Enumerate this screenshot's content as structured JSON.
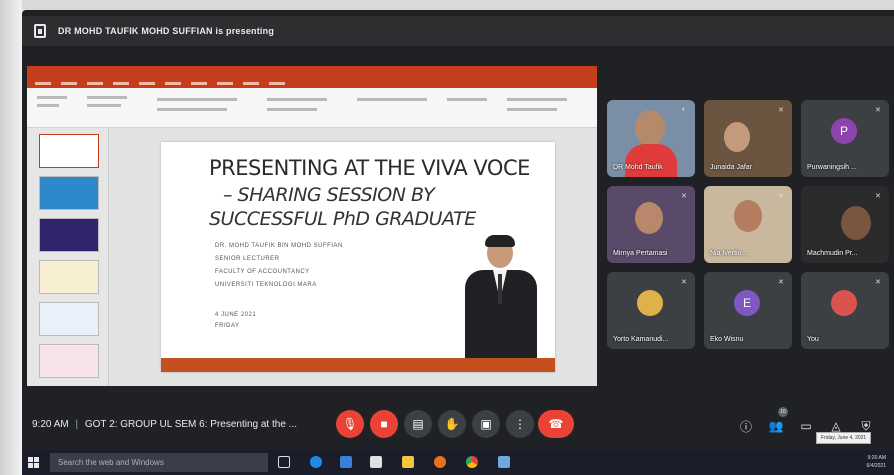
{
  "presenting_banner": {
    "text": "DR MOHD TAUFIK MOHD SUFFIAN is presenting"
  },
  "slide": {
    "title_line1": "PRESENTING AT THE VIVA VOCE",
    "title_line2": "– SHARING SESSION BY",
    "title_line3": "SUCCESSFUL PhD GRADUATE",
    "presenter_lines": [
      "DR. MOHD TAUFIK BIN MOHD SUFFIAN",
      "SENIOR LECTURER",
      "FACULTY OF ACCOUNTANCY",
      "UNIVERSITI TEKNOLOGI MARA"
    ],
    "date_lines": [
      "4 JUNE 2021",
      "FRIDAY"
    ]
  },
  "participants": [
    {
      "name": "DR Mohd Taufik"
    },
    {
      "name": "Junaida Jafar"
    },
    {
      "name": "Purwaningsih ...",
      "initial": "P"
    },
    {
      "name": "Mirnya Pertamasi"
    },
    {
      "name": "Nia Ivertin..."
    },
    {
      "name": "Machmudin Pr..."
    },
    {
      "name": "Yorto Kamanudi..."
    },
    {
      "name": "Eko Wisnu",
      "initial": "E"
    },
    {
      "name": "You"
    }
  ],
  "meeting": {
    "time": "9:20 AM",
    "title": "GOT 2: GROUP UL SEM 6: Presenting at the ..."
  },
  "participant_count_badge": "10",
  "tooltip": "Friday, June 4, 2021",
  "taskbar": {
    "search_placeholder": "Search the web and Windows",
    "clock_time": "9:20 AM",
    "clock_date": "6/4/2021"
  },
  "colors": {
    "meet_bg": "#202124",
    "tile_bg": "#3c4043",
    "ppt_accent": "#c43e1c",
    "end_call_red": "#ea4335"
  }
}
